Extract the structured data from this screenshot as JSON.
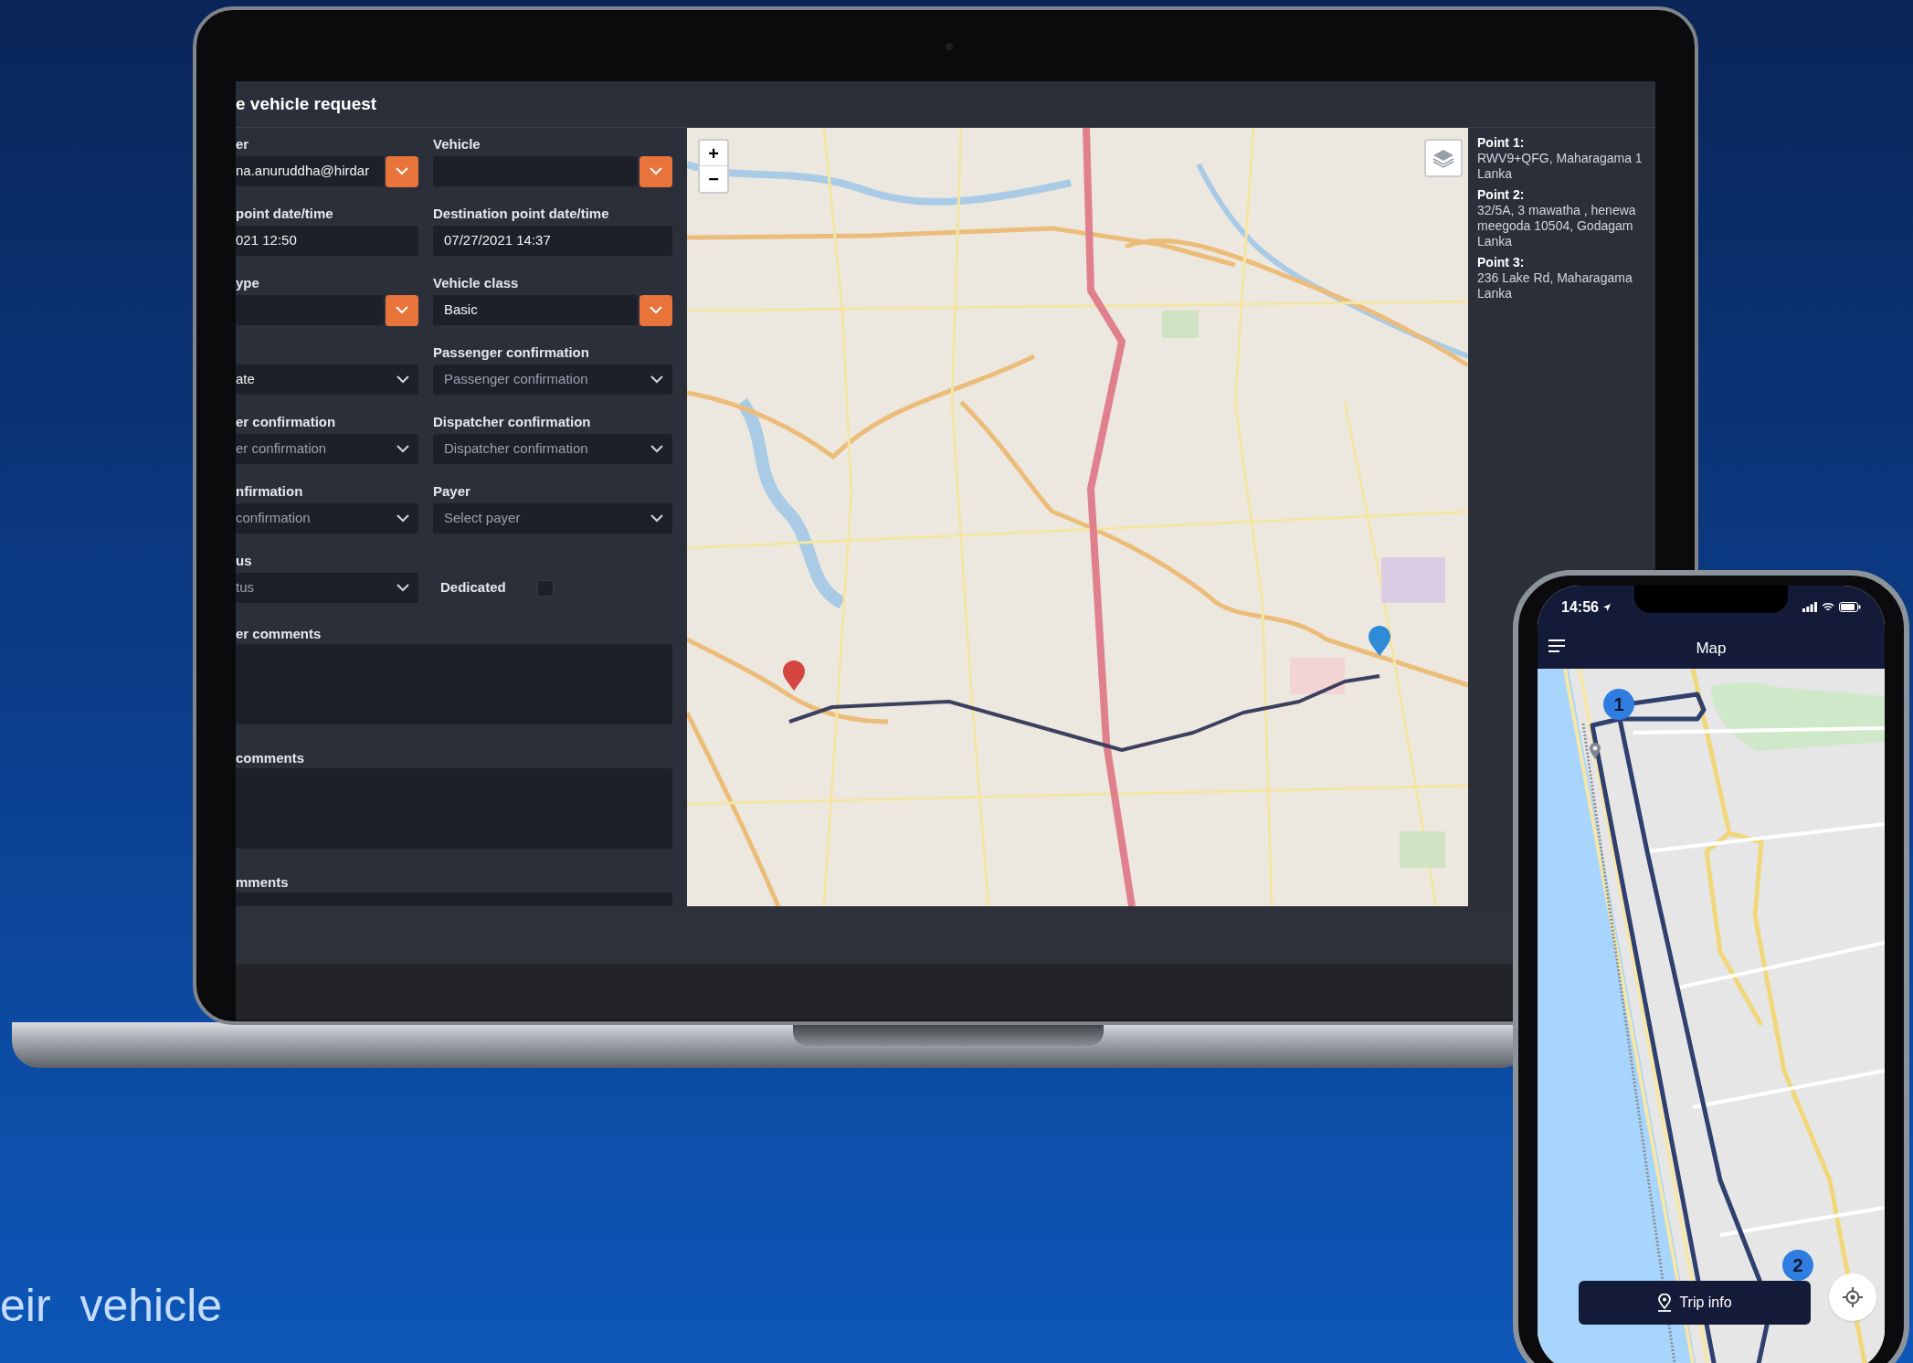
{
  "laptop": {
    "screen": {
      "title": "e vehicle request",
      "field_rows": [
        [
          {
            "label": "er",
            "kind": "combo",
            "value": "na.anuruddha@hirdar"
          },
          {
            "label": "Vehicle",
            "kind": "combo"
          }
        ],
        [
          {
            "label": "point date/time",
            "kind": "input",
            "value": "021 12:50"
          },
          {
            "label": "Destination point date/time",
            "kind": "input",
            "value": "07/27/2021 14:37"
          }
        ],
        [
          {
            "label": "ype",
            "kind": "combo"
          },
          {
            "label": "Vehicle class",
            "kind": "combo",
            "value": "Basic"
          }
        ],
        [
          {
            "kind": "select",
            "value": "ate"
          },
          {
            "label": "Passenger confirmation",
            "kind": "select",
            "placeholder": "Passenger confirmation"
          }
        ],
        [
          {
            "label": "er confirmation",
            "kind": "select",
            "placeholder": "er confirmation"
          },
          {
            "label": "Dispatcher confirmation",
            "kind": "select",
            "placeholder": "Dispatcher confirmation"
          }
        ],
        [
          {
            "label": "nfirmation",
            "kind": "select",
            "placeholder": "confirmation"
          },
          {
            "label": "Payer",
            "kind": "select",
            "placeholder": "Select payer"
          }
        ],
        [
          {
            "label": "us",
            "kind": "select",
            "placeholder": "tus"
          },
          {
            "label": "Dedicated",
            "kind": "checkbox",
            "checked": false
          }
        ]
      ],
      "comment_boxes": [
        {
          "label": "er comments"
        },
        {
          "label": "comments"
        },
        {
          "label": "mments"
        }
      ],
      "map": {
        "zoom_in": "+",
        "zoom_out": "−"
      },
      "points": [
        {
          "label": "Point 1:",
          "lines": [
            "RWV9+QFG, Maharagama 1",
            "Lanka"
          ]
        },
        {
          "label": "Point 2:",
          "lines": [
            "32/5A, 3 mawatha , henewa",
            "meegoda 10504, Godagam",
            "Lanka"
          ]
        },
        {
          "label": "Point 3:",
          "lines": [
            "236 Lake Rd, Maharagama",
            "Lanka"
          ]
        }
      ]
    }
  },
  "phone": {
    "status_time": "14:56",
    "title": "Map",
    "markers": [
      "1",
      "2"
    ],
    "trip_button": "Trip info"
  },
  "caption": "eir vehicle"
}
